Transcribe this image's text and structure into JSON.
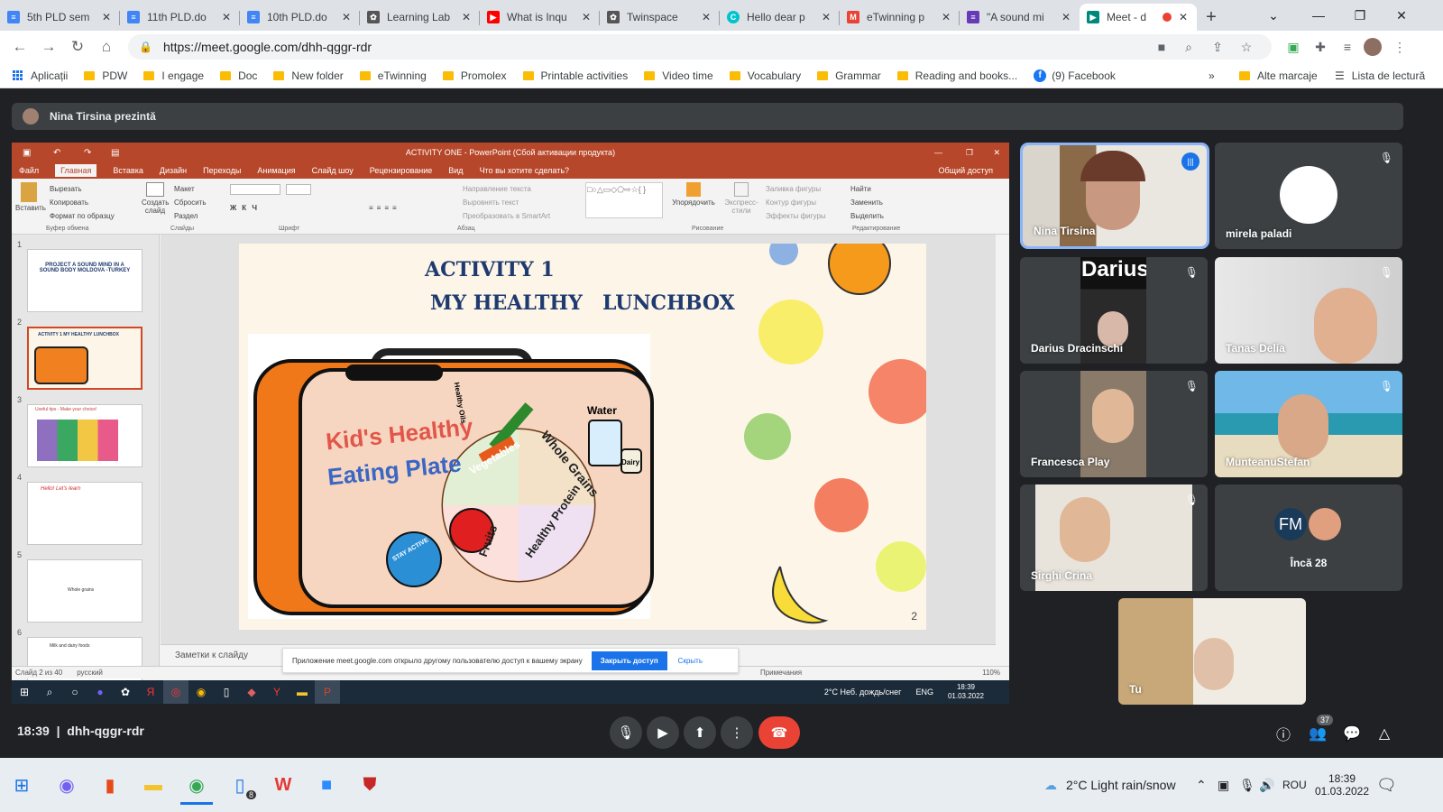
{
  "browser": {
    "tabs": [
      {
        "label": "5th PLD sem",
        "icon": "docs-icon",
        "color": "#4285f4"
      },
      {
        "label": "11th PLD.do",
        "icon": "docs-icon",
        "color": "#4285f4"
      },
      {
        "label": "10th PLD.do",
        "icon": "docs-icon",
        "color": "#4285f4"
      },
      {
        "label": "Learning Lab",
        "icon": "twinspace-icon",
        "color": "#555555"
      },
      {
        "label": "What is Inqu",
        "icon": "youtube-icon",
        "color": "#ff0000"
      },
      {
        "label": "Twinspace",
        "icon": "twinspace-icon",
        "color": "#555555"
      },
      {
        "label": "Hello dear p",
        "icon": "canva-icon",
        "color": "#00c4cc"
      },
      {
        "label": "eTwinning p",
        "icon": "gmail-icon",
        "color": "#ea4335"
      },
      {
        "label": "\"A sound mi",
        "icon": "forms-icon",
        "color": "#673ab7"
      },
      {
        "label": "Meet - d",
        "icon": "meet-icon",
        "color": "#00897b"
      }
    ],
    "url": "https://meet.google.com/dhh-qggr-rdr",
    "bookmarks": [
      "Aplicații",
      "PDW",
      "I engage",
      "Doc",
      "New folder",
      "eTwinning",
      "Promolex",
      "Printable activities",
      "Video time",
      "Vocabulary",
      "Grammar",
      "Reading and books...",
      "(9) Facebook"
    ],
    "bookmarks_more": "»",
    "other_bookmarks": "Alte marcaje",
    "reading_list": "Lista de lectură"
  },
  "meet": {
    "presenter": "Nina Tirsina prezintă",
    "time": "18:39",
    "code": "dhh-qggr-rdr",
    "people_count": "37",
    "tiles": [
      {
        "name": "Nina Tirsina"
      },
      {
        "name": "mirela paladi"
      },
      {
        "name": "Darius Dracinschi"
      },
      {
        "name": "Tanas Delia"
      },
      {
        "name": "Francesca Play"
      },
      {
        "name": "MunteanuStefan"
      },
      {
        "name": "Sirghi Crina"
      },
      {
        "name": "Încă 28",
        "initials": "FM"
      },
      {
        "name": "Tu"
      }
    ],
    "darius_banner": "Darius"
  },
  "powerpoint": {
    "title": "ACTIVITY ONE - PowerPoint (Сбой активации продукта)",
    "tabs": [
      "Файл",
      "Главная",
      "Вставка",
      "Дизайн",
      "Переходы",
      "Анимация",
      "Слайд шоу",
      "Рецензирование",
      "Вид",
      "Что вы хотите сделать?"
    ],
    "share_label": "Общий доступ",
    "ribbon": {
      "clipboard": [
        "Вырезать",
        "Копировать",
        "Формат по образцу"
      ],
      "paste": "Вставить",
      "clipboard_group": "Буфер обмена",
      "slides": [
        "Макет",
        "Сбросить",
        "Раздел"
      ],
      "new_slide": "Создать слайд",
      "slides_group": "Слайды",
      "font_group": "Шрифт",
      "paragraph_items": [
        "Направление текста",
        "Выровнять текст",
        "Преобразовать в SmartArt"
      ],
      "paragraph_group": "Абзац",
      "arrange": "Упорядочить",
      "quick_styles": "Экспресс-стили",
      "shape_items": [
        "Заливка фигуры",
        "Контур фигуры",
        "Эффекты фигуры"
      ],
      "drawing_group": "Рисование",
      "editing": [
        "Найти",
        "Заменить",
        "Выделить"
      ],
      "editing_group": "Редактирование"
    },
    "slide": {
      "title1": "ACTIVITY 1",
      "title2": "MY HEALTHY",
      "title3": "LUNCHBOX",
      "plate_text1": "Kid's Healthy",
      "plate_text2": "Eating Plate",
      "water": "Water",
      "dairy": "Dairy",
      "oils": "Healthy Oils",
      "vegetables": "Vegetables",
      "grains": "Whole Grains",
      "fruits": "Fruits",
      "protein": "Healthy Protein",
      "stay_active": "STAY ACTIVE",
      "number": "2"
    },
    "thumbs": [
      {
        "num": "1",
        "text": "PROJECT A SOUND MIND IN A SOUND BODY MOLDOVA -TURKEY"
      },
      {
        "num": "2",
        "text": "ACTIVITY 1 MY HEALTHY LUNCHBOX"
      },
      {
        "num": "3",
        "text": "Useful tips - Make your choice!"
      },
      {
        "num": "4",
        "text": "Hello! Let's learn"
      },
      {
        "num": "5",
        "text": "Whole grains"
      },
      {
        "num": "6",
        "text": "Milk and dairy foods"
      }
    ],
    "notes": "Заметки к слайду",
    "status": "Слайд 2 из 40",
    "language": "русский",
    "status_right": "Примечания",
    "zoom": "110%"
  },
  "share_notice": {
    "text": "Приложение meet.google.com открыло другому пользователю доступ к вашему экрану",
    "stop": "Закрыть доступ",
    "hide": "Скрыть"
  },
  "remote_taskbar": {
    "weather": "2°C Неб. дождь/снег",
    "lang": "ENG",
    "time": "18:39",
    "date": "01.03.2022"
  },
  "taskbar": {
    "weather": "2°C Light rain/snow",
    "lang": "ROU",
    "time": "18:39",
    "date": "01.03.2022",
    "badge": "8"
  },
  "colors": {
    "pp_accent": "#b7472a",
    "meet_bg": "#202124",
    "end_call": "#ea4335",
    "highlight": "#8ab4f8"
  }
}
